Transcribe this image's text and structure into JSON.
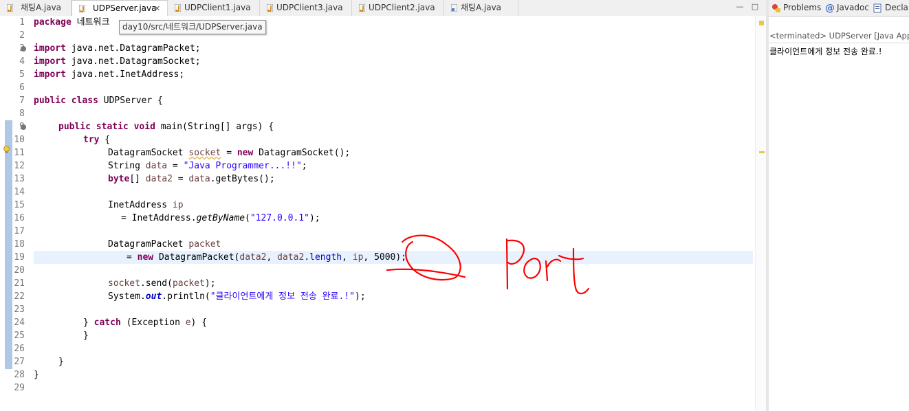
{
  "tabs": [
    {
      "label": "채팅A.java",
      "active": false
    },
    {
      "label": "UDPServer.java",
      "active": true
    },
    {
      "label": "UDPClient1.java",
      "active": false
    },
    {
      "label": "UDPClient3.java",
      "active": false
    },
    {
      "label": "UDPClient2.java",
      "active": false
    },
    {
      "label": "채팅A.java",
      "active": false
    }
  ],
  "tab_close_glyph": "✕",
  "tooltip": "day10/src/네트워크/UDPServer.java",
  "line_numbers": [
    "1",
    "2",
    "3",
    "4",
    "5",
    "6",
    "7",
    "8",
    "9",
    "10",
    "11",
    "12",
    "13",
    "14",
    "15",
    "16",
    "17",
    "18",
    "19",
    "20",
    "21",
    "22",
    "23",
    "24",
    "25",
    "26",
    "27",
    "28",
    "29"
  ],
  "code": {
    "l1_kw": "package",
    "l1_rest": " 네트워크",
    "l3_kw": "import",
    "l3_rest": " java.net.DatagramPacket;",
    "l4_kw": "import",
    "l4_rest": " java.net.DatagramSocket;",
    "l5_kw": "import",
    "l5_rest": " java.net.InetAddress;",
    "l7_kw1": "public",
    "l7_kw2": "class",
    "l7_rest": " UDPServer {",
    "l9_kw1": "public",
    "l9_kw2": "static",
    "l9_kw3": "void",
    "l9_rest": " main(String[] args) {",
    "l10_kw": "try",
    "l10_rest": " {",
    "l11_a": "DatagramSocket ",
    "l11_var": "socket",
    "l11_b": " = ",
    "l11_kw": "new",
    "l11_c": " DatagramSocket();",
    "l12_a": "String ",
    "l12_var": "data",
    "l12_b": " = ",
    "l12_str": "\"Java Programmer...!!\"",
    "l12_c": ";",
    "l13_kw": "byte",
    "l13_a": "[] ",
    "l13_var": "data2",
    "l13_b": " = ",
    "l13_var2": "data",
    "l13_c": ".getBytes();",
    "l15_a": "InetAddress ",
    "l15_var": "ip",
    "l16_a": "= InetAddress.",
    "l16_it": "getByName",
    "l16_b": "(",
    "l16_str": "\"127.0.0.1\"",
    "l16_c": ");",
    "l18_a": "DatagramPacket ",
    "l18_var": "packet",
    "l19_a": "= ",
    "l19_kw": "new",
    "l19_b": " DatagramPacket(",
    "l19_var1": "data2",
    "l19_c": ", ",
    "l19_var2": "data2",
    "l19_d": ".",
    "l19_fld": "length",
    "l19_e": ", ",
    "l19_var3": "ip",
    "l19_f": ", 5000);",
    "l21_var": "socket",
    "l21_a": ".send(",
    "l21_var2": "packet",
    "l21_b": ");",
    "l22_a": "System.",
    "l22_fld": "out",
    "l22_b": ".println(",
    "l22_str": "\"클라이언트에게 정보 전송 완료.!\"",
    "l22_c": ");",
    "l24_a": "} ",
    "l24_kw": "catch",
    "l24_b": " (Exception ",
    "l24_var": "e",
    "l24_c": ") {",
    "l25": "}",
    "l27": "}",
    "l28": "}"
  },
  "right_tabs": {
    "problems": "Problems",
    "javadoc": "Javadoc",
    "decl": "Decla"
  },
  "console": {
    "terminated": "<terminated> UDPServer [Java Applic",
    "output": "클라이언트에게 정보 전송 완료.!"
  },
  "annotation": {
    "text": "Port",
    "color": "#ff0000"
  },
  "colors": {
    "keyword": "#7f0055",
    "string": "#2a00ff",
    "field": "#0000c0",
    "local_var": "#6a3e3e",
    "current_line": "#e8f2fe"
  }
}
